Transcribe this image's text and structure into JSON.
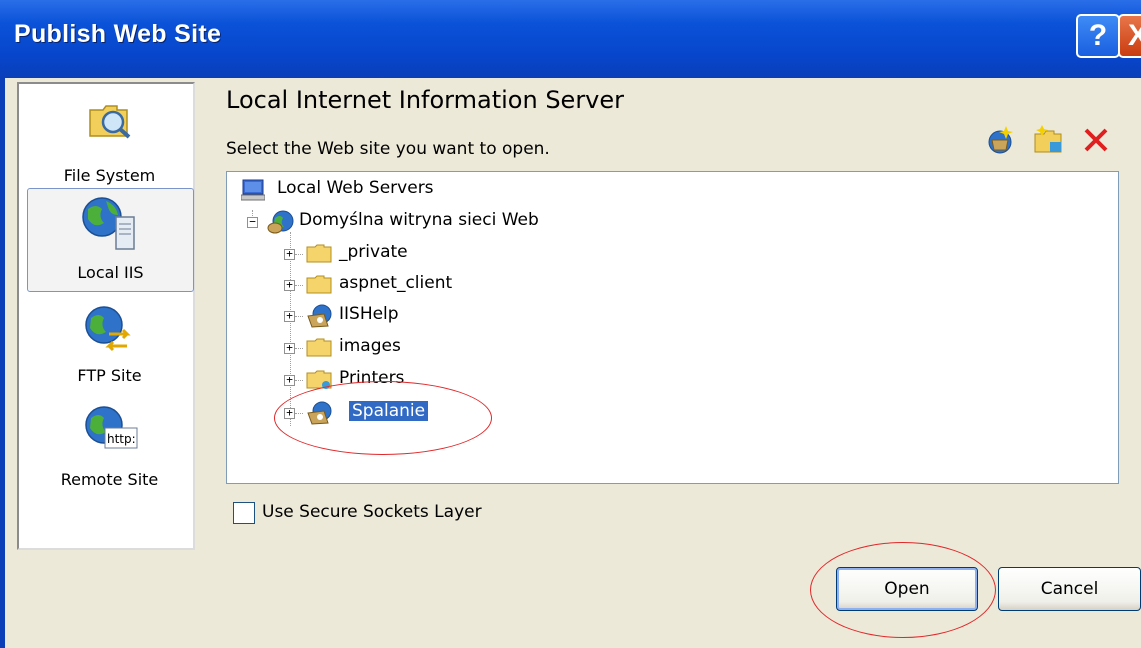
{
  "window": {
    "title": "Publish Web Site",
    "help_button": "?",
    "close_button": "X"
  },
  "sidebar": {
    "items": [
      {
        "label": "File System",
        "icon": "folder-search-icon"
      },
      {
        "label": "Local IIS",
        "icon": "local-iis-globe-icon",
        "selected": true
      },
      {
        "label": "FTP Site",
        "icon": "ftp-globe-icon"
      },
      {
        "label": "Remote Site",
        "icon": "remote-globe-http-icon",
        "icon_text": "http:"
      }
    ]
  },
  "main": {
    "heading": "Local Internet Information Server",
    "prompt": "Select the Web site you want to open.",
    "toolbar": [
      "create-new-web-application-icon",
      "create-new-virtual-directory-icon",
      "delete-icon"
    ],
    "tree": {
      "root": "Local Web Servers",
      "site": "Domyślna witryna sieci Web",
      "children": [
        {
          "label": "_private",
          "icon": "folder-icon"
        },
        {
          "label": "aspnet_client",
          "icon": "folder-icon"
        },
        {
          "label": "IISHelp",
          "icon": "web-application-icon"
        },
        {
          "label": "images",
          "icon": "folder-icon"
        },
        {
          "label": "Printers",
          "icon": "shared-folder-icon"
        },
        {
          "label": "Spalanie",
          "icon": "web-application-icon",
          "selected": true
        }
      ]
    },
    "ssl_label": "Use Secure Sockets Layer",
    "ssl_checked": false
  },
  "buttons": {
    "open": "Open",
    "cancel": "Cancel"
  },
  "colors": {
    "titlebar": "#0a52d8",
    "selection": "#316ac5",
    "annotation": "#e0282a"
  }
}
